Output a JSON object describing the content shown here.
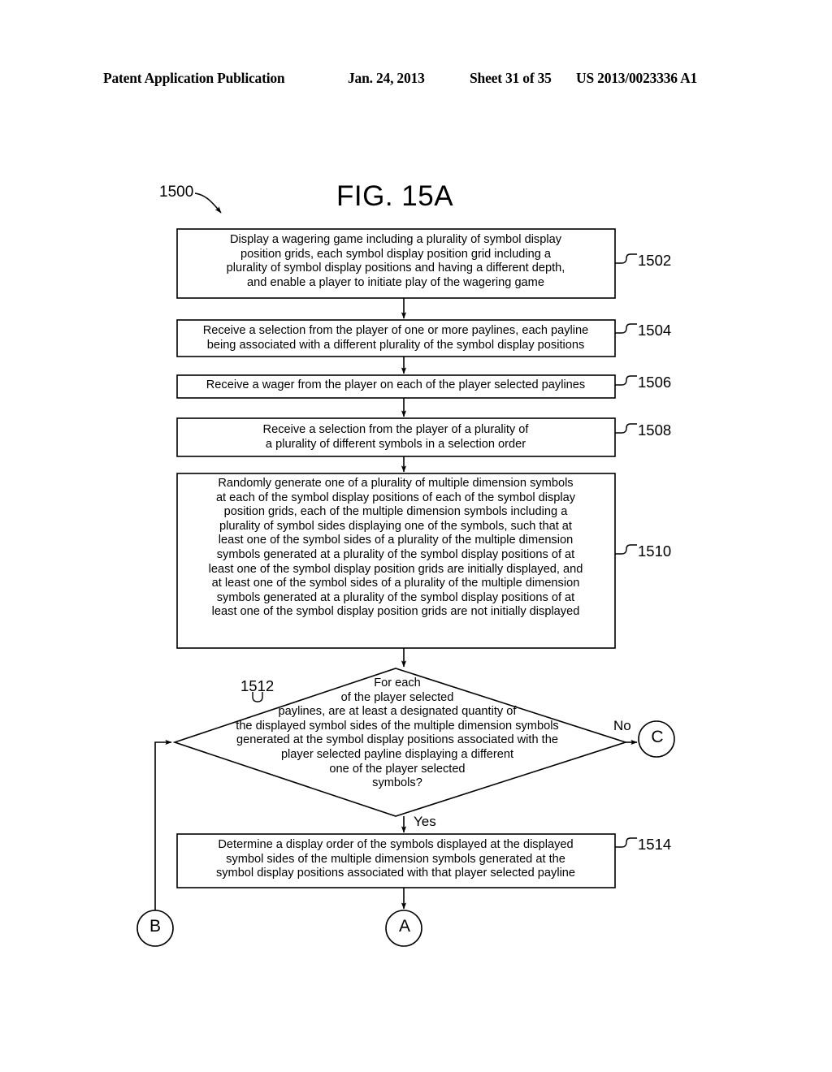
{
  "header": {
    "publication": "Patent Application Publication",
    "date": "Jan. 24, 2013",
    "sheet": "Sheet 31 of 35",
    "doc_number": "US 2013/0023336 A1"
  },
  "figure": {
    "title": "FIG. 15A",
    "reference": "1500"
  },
  "flowchart": {
    "nodes": [
      {
        "id": "1502",
        "shape": "process",
        "ref": "1502",
        "text": "Display a wagering game including a plurality of symbol display\nposition grids, each symbol display position grid including a\nplurality of symbol display positions and having a different depth,\nand enable a player to initiate play of the wagering game"
      },
      {
        "id": "1504",
        "shape": "process",
        "ref": "1504",
        "text": "Receive a selection from the player of one or more paylines, each payline\nbeing associated with a different plurality of the symbol display positions"
      },
      {
        "id": "1506",
        "shape": "process",
        "ref": "1506",
        "text": "Receive a wager from the player on each of the player selected paylines"
      },
      {
        "id": "1508",
        "shape": "process",
        "ref": "1508",
        "text": "Receive a selection from the player of a plurality of\na plurality of different symbols in a selection order"
      },
      {
        "id": "1510",
        "shape": "process",
        "ref": "1510",
        "text": "Randomly generate one of a plurality of multiple dimension symbols\nat each of the symbol display positions of each of the symbol display\nposition grids, each of the multiple dimension symbols including a\nplurality of symbol sides displaying one of the symbols, such that at\nleast one of the symbol sides of a plurality of the multiple dimension\nsymbols generated at a plurality of the symbol display positions of at\nleast one of the symbol display position grids are initially displayed, and\nat least one of the symbol sides of a plurality of the multiple dimension\nsymbols generated at a plurality of the symbol display positions of at\nleast one of the symbol display position grids are not initially displayed"
      },
      {
        "id": "1512",
        "shape": "decision",
        "ref": "1512",
        "text": "For each\nof the player selected\npaylines, are at least a designated quantity of\nthe displayed symbol sides of the multiple dimension symbols\ngenerated at the symbol display positions associated with the\nplayer selected payline displaying a different\none of the player selected\nsymbols?"
      },
      {
        "id": "1514",
        "shape": "process",
        "ref": "1514",
        "text": "Determine a display order of the symbols displayed at the displayed\nsymbol sides of the multiple dimension symbols generated at the\nsymbol display positions associated with that player selected payline"
      }
    ],
    "edge_labels": {
      "no": "No",
      "yes": "Yes"
    },
    "connectors": [
      {
        "id": "connector-b",
        "label": "B"
      },
      {
        "id": "connector-a",
        "label": "A"
      },
      {
        "id": "connector-c",
        "label": "C"
      }
    ]
  },
  "colors": {
    "ink": "#000000",
    "paper": "#ffffff"
  }
}
